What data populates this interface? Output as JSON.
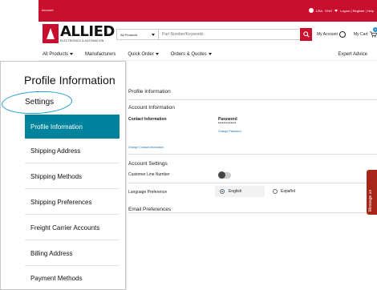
{
  "topbar": {
    "account": "Account",
    "locale": "USA · ENG",
    "links": "Logout | Register | Help"
  },
  "brand": {
    "name": "ALLIED",
    "tagline": "ELECTRONICS & AUTOMATION"
  },
  "search": {
    "category": "All Products",
    "placeholder": "Part Number/Keywords"
  },
  "header": {
    "my_account": "My Account",
    "my_cart": "My Cart",
    "cart_count": "0"
  },
  "nav": {
    "all_products": "All Products",
    "manufacturers": "Manufacturers",
    "quick_order": "Quick Order",
    "orders_quotes": "Orders & Quotes",
    "expert_advice": "Expert Advice"
  },
  "main": {
    "title": "Profile Information",
    "account_info_title": "Account Information",
    "contact_info_label": "Contact Information",
    "password_label": "Password",
    "password_value": "••••••••••",
    "change_password": "Change Password",
    "change_contact": "Change Contact Information",
    "account_settings_title": "Account Settings",
    "customer_line_label": "Customer Line Number",
    "language_label": "Language Preference",
    "lang_english": "English",
    "lang_spanish": "Español",
    "email_prefs_title": "Email Preferences"
  },
  "message_tab": "Message us",
  "sidebar": {
    "title": "Profile Information",
    "settings": "Settings",
    "items": [
      {
        "label": "Profile Information",
        "active": true
      },
      {
        "label": "Shipping Address",
        "active": false
      },
      {
        "label": "Shipping Methods",
        "active": false
      },
      {
        "label": "Shipping Preferences",
        "active": false
      },
      {
        "label": "Freight Carrier Accounts",
        "active": false
      },
      {
        "label": "Billing Address",
        "active": false
      },
      {
        "label": "Payment Methods",
        "active": false
      }
    ]
  },
  "colors": {
    "brand_red": "#c8102e",
    "active_teal": "#00839c",
    "highlight_ring": "#1a9ad6"
  }
}
